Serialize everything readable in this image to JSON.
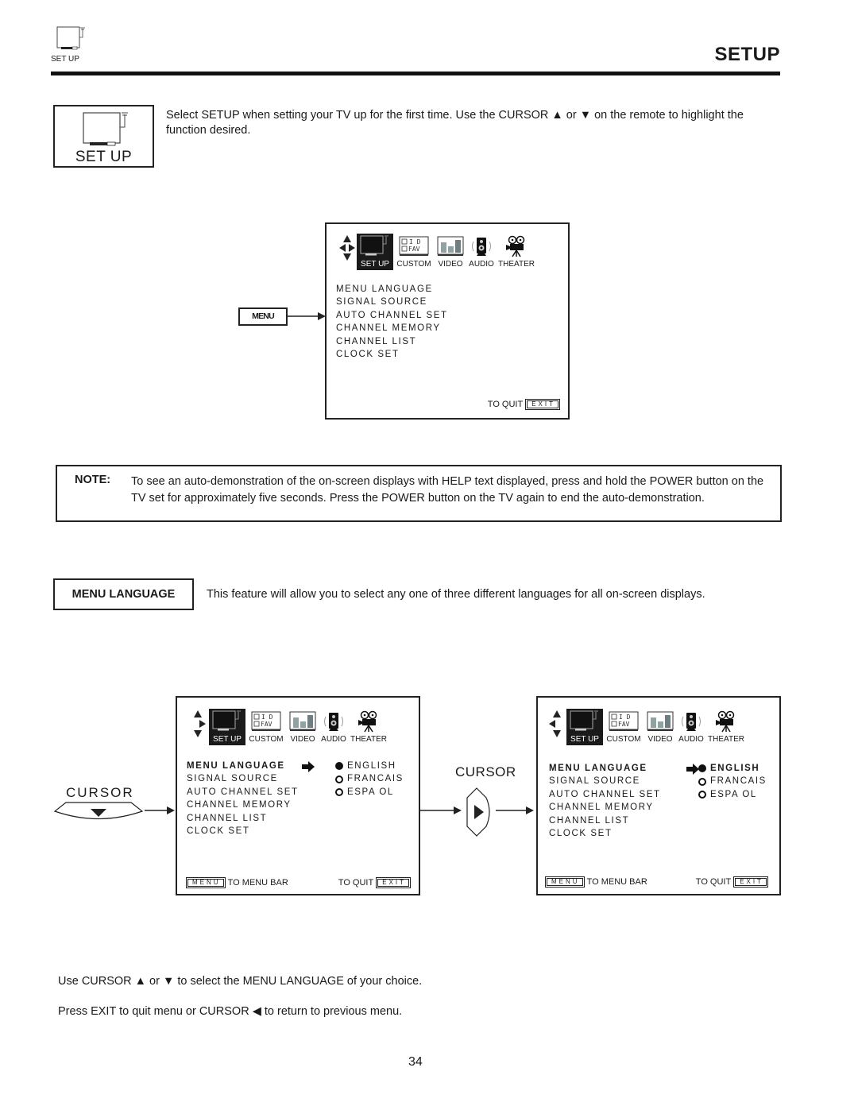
{
  "header": {
    "icon_label": "SET UP",
    "section_title": "SETUP"
  },
  "setup_box": {
    "label": "SET UP"
  },
  "intro_text": "Select SETUP when setting your TV up for the first time.  Use the CURSOR ▲ or ▼ on the remote to highlight the function desired.",
  "menubar": {
    "tabs": [
      {
        "id": "setup",
        "label": "SET UP",
        "icon": "tv-icon"
      },
      {
        "id": "custom",
        "label": "CUSTOM",
        "icon": "id-fav-icon"
      },
      {
        "id": "video",
        "label": "VIDEO",
        "icon": "video-bars-icon"
      },
      {
        "id": "audio",
        "label": "AUDIO",
        "icon": "speaker-icon"
      },
      {
        "id": "theater",
        "label": "THEATER",
        "icon": "movie-camera-icon"
      }
    ],
    "custom_icon_text": [
      "I D",
      "F A V"
    ]
  },
  "menu_button_label": "MENU",
  "setup_menu_items": [
    "MENU LANGUAGE",
    "SIGNAL SOURCE",
    "AUTO CHANNEL SET",
    "CHANNEL MEMORY",
    "CHANNEL LIST",
    "CLOCK SET"
  ],
  "to_quit_label": "TO QUIT",
  "exit_key_label": "EXIT",
  "menu_key_label": "MENU",
  "to_menu_bar_label": "TO MENU BAR",
  "note": {
    "label": "NOTE:",
    "text": "To see an auto-demonstration of the on-screen displays with HELP text displayed, press and hold the POWER button on the TV set for approximately five seconds. Press the POWER button on the TV again to end the auto-demonstration."
  },
  "menu_language": {
    "box_label": "MENU LANGUAGE",
    "description": "This feature will allow you to select any one of three different languages for all on-screen displays.",
    "options": [
      {
        "label": "ENGLISH",
        "selected": true
      },
      {
        "label": "FRANCAIS",
        "selected": false
      },
      {
        "label": "ESPA OL",
        "selected": false
      }
    ]
  },
  "cursor_label": "CURSOR",
  "instructions": [
    "Use CURSOR ▲ or ▼ to select the MENU LANGUAGE of your choice.",
    "Press EXIT to quit menu or CURSOR ◀ to return to previous menu."
  ],
  "page_number": "34"
}
